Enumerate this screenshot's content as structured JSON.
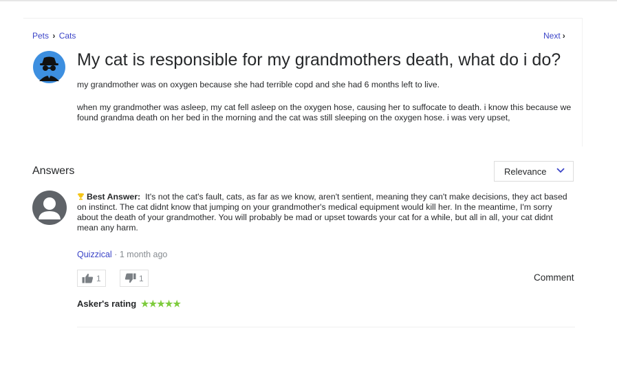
{
  "breadcrumb": {
    "parent": "Pets",
    "separator": "›",
    "current": "Cats"
  },
  "nav": {
    "next_label": "Next",
    "next_chevron": "›"
  },
  "question": {
    "title": "My cat is responsible for my grandmothers death, what do i do?",
    "paragraphs": [
      "my grandmother was on oxygen because she had terrible copd and she had 6 months left to live.",
      "when my grandmother was asleep, my cat fell asleep on the oxygen hose, causing her to suffocate to death. i know this because we found grandma death on her bed in the morning and the cat was still sleeping on the oxygen hose. i was very upset,"
    ]
  },
  "answers_section": {
    "heading": "Answers",
    "sort_label": "Relevance"
  },
  "answer": {
    "badge": "Best Answer:",
    "text": "It's not the cat's fault, cats, as far as we know, aren't sentient, meaning they can't make decisions, they act based on instinct. The cat didnt know that jumping on your grandmother's medical equipment would kill her. In the meantime, I'm sorry about the death of your grandmother. You will probably be mad or upset towards your cat for a while, but all in all, your cat didnt mean any harm.",
    "author": "Quizzical",
    "meta_separator": "·",
    "time": "1 month ago",
    "upvotes": "1",
    "downvotes": "1",
    "comment_label": "Comment",
    "rating_label": "Asker's rating",
    "rating_stars": "★★★★★",
    "rating_value": 5
  },
  "colors": {
    "link": "#3a43c7",
    "stars": "#7dcb3c",
    "trophy": "#f5c518",
    "avatar_blue": "#3d8fe0"
  },
  "icons": [
    "chevron-right-icon",
    "incognito-avatar-icon",
    "default-user-avatar-icon",
    "trophy-icon",
    "chevron-down-icon",
    "thumbs-up-icon",
    "thumbs-down-icon",
    "star-icon"
  ]
}
